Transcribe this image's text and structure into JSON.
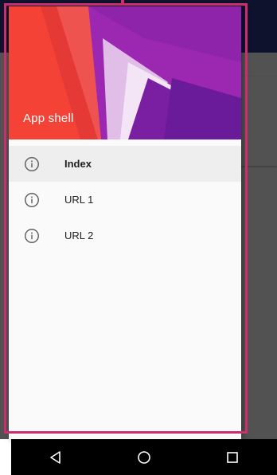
{
  "drawer": {
    "header_title": "App shell",
    "items": [
      {
        "label": "Index",
        "icon": "info-icon",
        "active": true
      },
      {
        "label": "URL 1",
        "icon": "info-icon",
        "active": false
      },
      {
        "label": "URL 2",
        "icon": "info-icon",
        "active": false
      }
    ]
  },
  "system_nav": {
    "buttons": [
      "back-icon",
      "home-icon",
      "recents-icon"
    ]
  },
  "colors": {
    "toolbar": "#2d3a8c",
    "highlight_frame": "#cc2e6d",
    "header_red": "#f44336",
    "header_purple": "#9c27b0"
  }
}
